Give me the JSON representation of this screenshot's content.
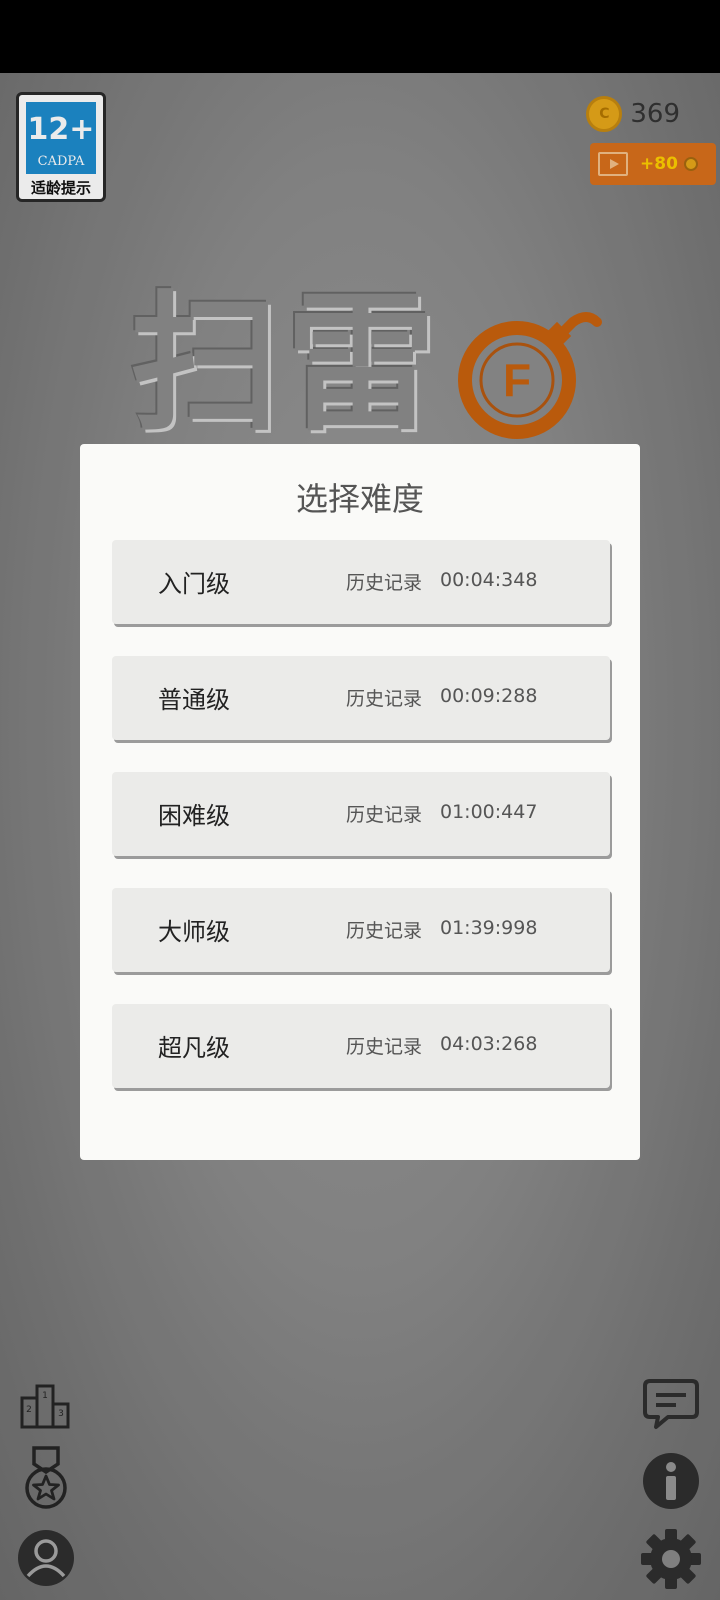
{
  "age_rating": {
    "number": "12+",
    "org": "CADPA",
    "tip": "适龄提示"
  },
  "coins": {
    "count": "369",
    "coin_symbol": "C",
    "reward": "+80"
  },
  "game_title": "扫雷",
  "bomb_letter": "F",
  "dialog": {
    "title": "选择难度",
    "levels": [
      {
        "name": "入门级",
        "record_label": "历史记录",
        "record_time": "00:04:348"
      },
      {
        "name": "普通级",
        "record_label": "历史记录",
        "record_time": "00:09:288"
      },
      {
        "name": "困难级",
        "record_label": "历史记录",
        "record_time": "01:00:447"
      },
      {
        "name": "大师级",
        "record_label": "历史记录",
        "record_time": "01:39:998"
      },
      {
        "name": "超凡级",
        "record_label": "历史记录",
        "record_time": "04:03:268"
      }
    ]
  },
  "podium_numbers": [
    "1",
    "2",
    "3"
  ],
  "colors": {
    "accent_orange": "#d9701c",
    "coin_gold": "#e8a81a",
    "badge_blue": "#1e8ccf"
  }
}
